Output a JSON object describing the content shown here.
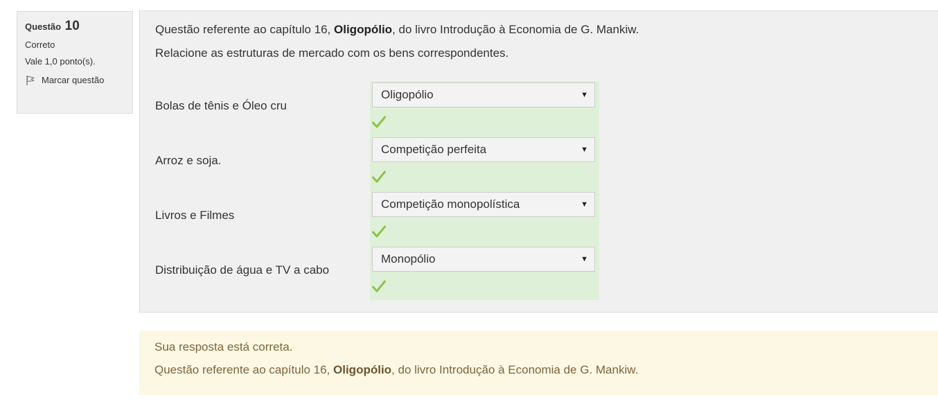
{
  "question_info": {
    "label": "Questão",
    "number": "10",
    "state": "Correto",
    "grade": "Vale 1,0 ponto(s).",
    "flag_label": "Marcar questão"
  },
  "question": {
    "intro_before": "Questão referente ao capítulo 16, ",
    "intro_bold": "Oligopólio",
    "intro_after": ", do livro Introdução à Economia de G. Mankiw.",
    "instruction": "Relacione as estruturas de mercado com os bens correspondentes."
  },
  "rows": [
    {
      "label": "Bolas de tênis e Óleo cru",
      "selected": "Oligopólio"
    },
    {
      "label": "Arroz e soja.",
      "selected": "Competição perfeita"
    },
    {
      "label": "Livros e Filmes",
      "selected": "Competição monopolística"
    },
    {
      "label": "Distribuição de água e TV a cabo",
      "selected": "Monopólio"
    }
  ],
  "feedback": {
    "result": "Sua resposta está correta.",
    "general_before": "Questão referente ao capítulo 16, ",
    "general_bold": "Oligopólio",
    "general_after": ", do livro Introdução à Economia de G. Mankiw."
  },
  "colors": {
    "correct_bg": "#dff0d8",
    "check": "#8bc34a",
    "feedback_bg": "#fcf8e3"
  }
}
